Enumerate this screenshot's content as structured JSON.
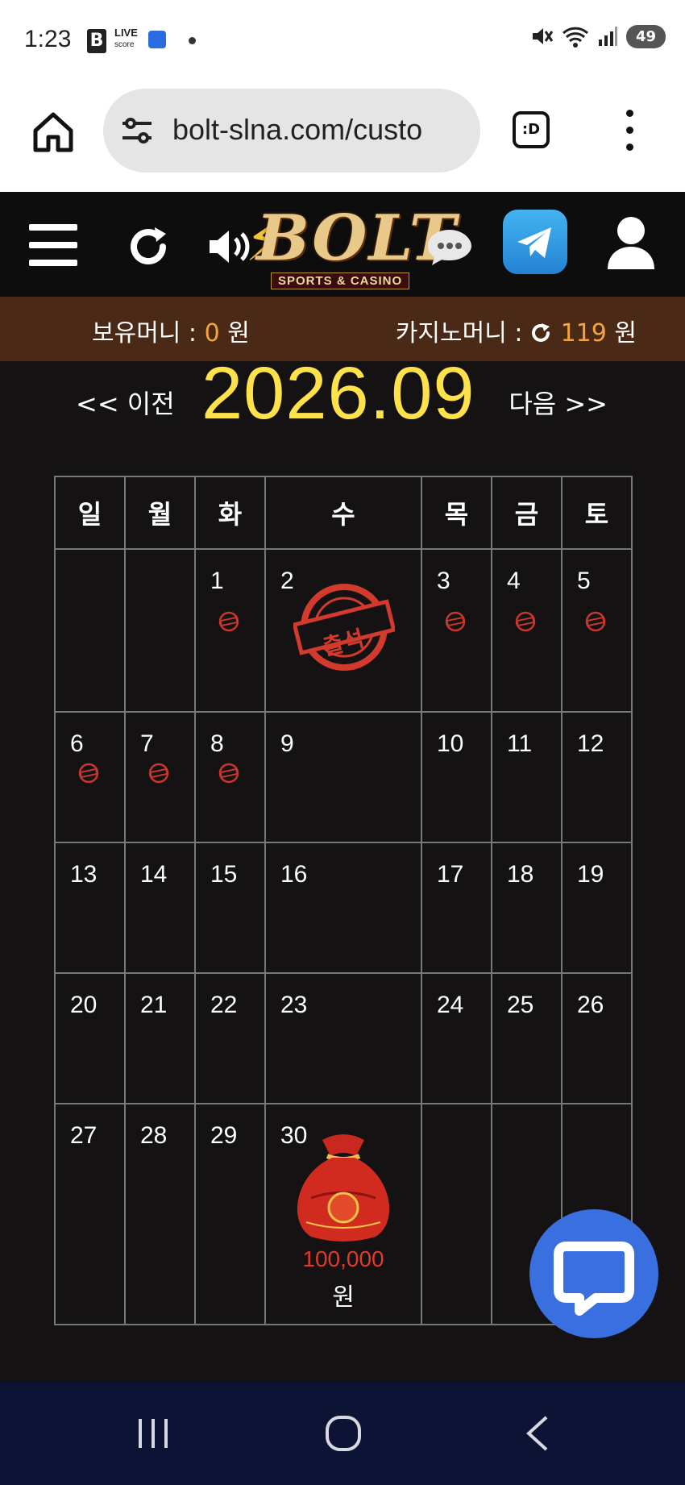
{
  "status_bar": {
    "time": "1:23",
    "live_label": "LIVE",
    "score_label": "score",
    "battery": "49"
  },
  "browser": {
    "url": "bolt-slna.com/custo",
    "tabs_label": ":D"
  },
  "site": {
    "logo_text": "BOLT",
    "logo_tagline": "SPORTS & CASINO"
  },
  "money": {
    "hold_label": "보유머니 :",
    "hold_value": "0",
    "hold_unit": "원",
    "casino_label": "카지노머니 :",
    "casino_value": "119",
    "casino_unit": "원"
  },
  "calendar": {
    "prev_label": "<< 이전",
    "next_label": "다음 >>",
    "month_title": "2026.09",
    "weekdays": [
      "일",
      "월",
      "화",
      "수",
      "목",
      "금",
      "토"
    ],
    "stamp_text": "출석",
    "rows": [
      [
        "",
        "",
        "1",
        "2",
        "3",
        "4",
        "5"
      ],
      [
        "6",
        "7",
        "8",
        "9",
        "10",
        "11",
        "12"
      ],
      [
        "13",
        "14",
        "15",
        "16",
        "17",
        "18",
        "19"
      ],
      [
        "20",
        "21",
        "22",
        "23",
        "24",
        "25",
        "26"
      ],
      [
        "27",
        "28",
        "29",
        "30",
        "",
        "",
        ""
      ]
    ],
    "prize_amount": "100,000",
    "prize_unit": "원"
  },
  "colors": {
    "accent_yellow": "#ffe14a",
    "accent_orange": "#f3a43c",
    "money_bar": "#4a2a16",
    "stamp_red": "#d23a2e",
    "chat_blue": "#3a6fe0"
  }
}
